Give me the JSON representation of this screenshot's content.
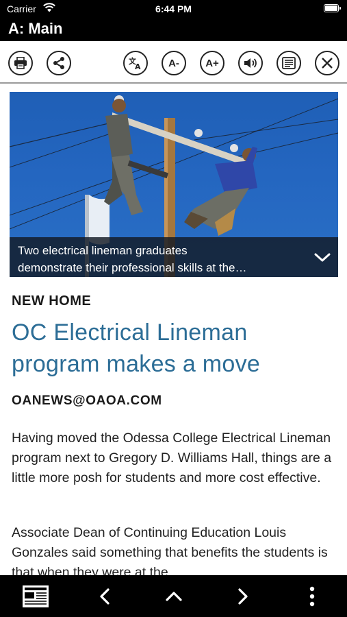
{
  "status": {
    "carrier": "Carrier",
    "time": "6:44 PM"
  },
  "header": {
    "title": "A: Main"
  },
  "toolbar": {
    "font_smaller_label": "A-",
    "font_larger_label": "A+"
  },
  "hero": {
    "caption": "Two electrical lineman graduates demonstrate their professional skills at the…",
    "caption_line1": "Two electrical lineman graduates",
    "caption_line2": "demonstrate their professional skills at the…"
  },
  "article": {
    "kicker": "NEW HOME",
    "headline_line1": "OC Electrical Lineman",
    "headline_line2": "program makes a move",
    "byline": "OANEWS@OAOA.COM",
    "paragraphs": [
      "Having moved the Odessa College Electrical Lineman program next to Gregory D. Williams Hall, things are a little more posh for students and more cost effective.",
      "Associate Dean of Continuing Education Louis Gonzales said something that benefits the students is that when they were at the"
    ]
  },
  "icons": {
    "print": "printer-icon",
    "share": "share-icon",
    "translate": "translate-icon",
    "speaker": "speaker-icon",
    "reader": "reader-view-icon",
    "close": "close-icon",
    "newspaper": "newspaper-icon",
    "back": "chevron-left-icon",
    "up": "chevron-up-icon",
    "forward": "chevron-right-icon",
    "more": "more-vertical-icon"
  },
  "colors": {
    "headline": "#2c6d96",
    "bar_background": "#000000",
    "sky": "#2466c0"
  }
}
